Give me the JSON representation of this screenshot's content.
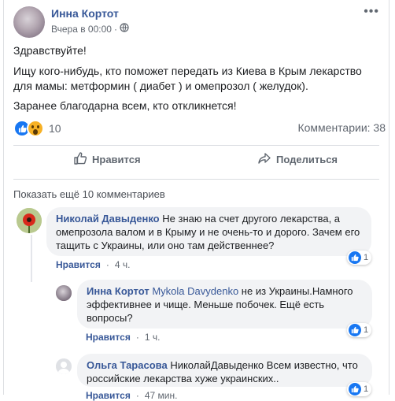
{
  "post": {
    "author": "Инна Кортот",
    "time": "Вчера в 00:00",
    "greeting": "Здравствуйте!",
    "body_line1": "Ищу кого-нибудь, кто поможет передать из Киева в Крым лекарство для мамы: метформин ( диабет ) и омепрозол ( желудок).",
    "body_line2": "Заранее благодарна всем, кто откликнется!",
    "reactions_count": "10",
    "comments_count": "Комментарии: 38",
    "like_label": "Нравится",
    "share_label": "Поделиться"
  },
  "comments": {
    "show_more": "Показать ещё 10 комментариев",
    "items": [
      {
        "author": "Николай Давыденко",
        "text": "Не знаю на счет другого лекарства, а омепрозола валом и в Крыму и не очень-то и дорого. Зачем его тащить с Украины, или оно там действеннее?",
        "like": "Нравится",
        "time": "4 ч.",
        "reactions": "1"
      },
      {
        "author": "Инна Кортот",
        "tag": "Mykola Davydenko",
        "text": "не из Украины.Намного эффективнее и чище. Меньше побочек. Ещё есть вопросы?",
        "like": "Нравится",
        "time": "1 ч.",
        "reactions": "1"
      },
      {
        "author": "Ольга Тарасова",
        "text": "НиколайДавыденко Всем известно, что российские лекарства хуже украинских..",
        "like": "Нравится",
        "time": "47 мин.",
        "reactions": "1"
      }
    ]
  },
  "icons": {
    "more": "more-icon",
    "globe": "globe-icon",
    "like": "thumbs-up-icon",
    "share": "share-icon"
  },
  "colors": {
    "link": "#385898",
    "like_blue": "#1877f2",
    "wow_yellow": "#f7b125",
    "bubble": "#f2f3f5",
    "muted": "#606770"
  }
}
